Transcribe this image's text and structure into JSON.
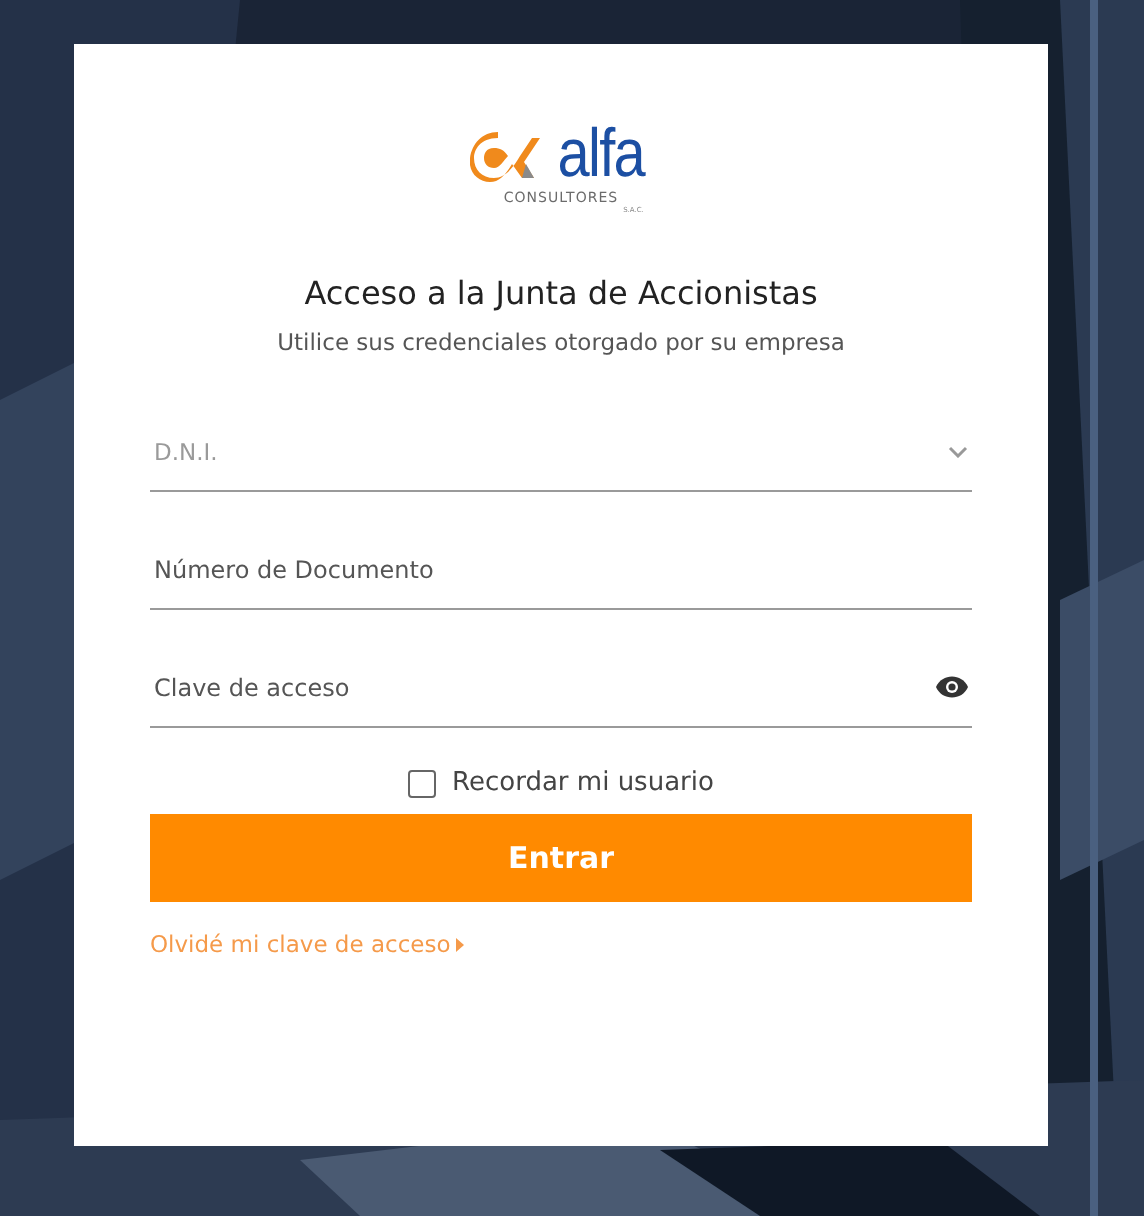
{
  "logo": {
    "name": "alfa",
    "subtitle": "CONSULTORES",
    "suffix": "S.A.C."
  },
  "title": "Acceso a la Junta de Accionistas",
  "subtitle": "Utilice sus credenciales otorgado por su empresa",
  "document_type": {
    "value": "D.N.I."
  },
  "fields": [
    {
      "kind": "text",
      "placeholder": "Número de Documento"
    },
    {
      "kind": "password",
      "placeholder": "Clave de acceso"
    }
  ],
  "remember": {
    "label": "Recordar mi usuario",
    "checked": false
  },
  "submit": "Entrar",
  "forgot_link": "Olvidé mi clave de acceso"
}
